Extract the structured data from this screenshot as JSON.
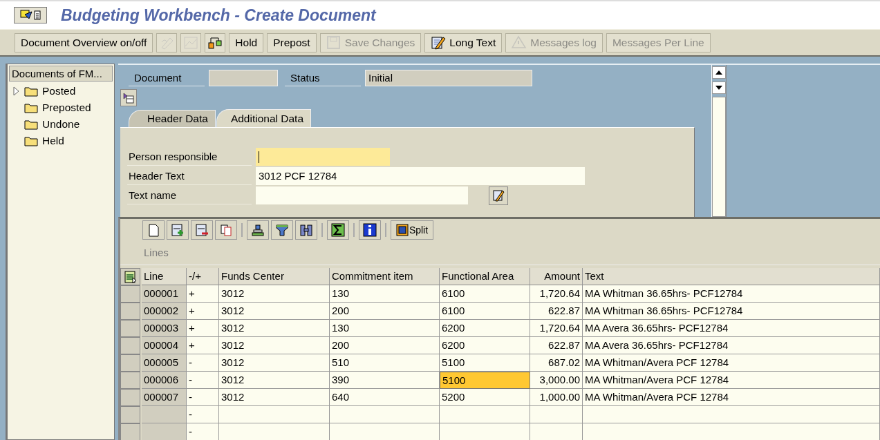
{
  "window": {
    "title": "Budgeting Workbench - Create Document"
  },
  "toolbar": [
    {
      "kind": "text",
      "label": "Document Overview on/off",
      "disabled": false
    },
    {
      "kind": "icon",
      "disabled": true
    },
    {
      "kind": "icon",
      "disabled": true
    },
    {
      "kind": "icon",
      "disabled": false
    },
    {
      "kind": "text",
      "label": "Hold",
      "disabled": false
    },
    {
      "kind": "text",
      "label": "Prepost",
      "disabled": false
    },
    {
      "kind": "icon_text",
      "label": "Save Changes",
      "disabled": true
    },
    {
      "kind": "icon_text",
      "label": "Long Text",
      "disabled": false
    },
    {
      "kind": "icon_text",
      "label": "Messages log",
      "disabled": true
    },
    {
      "kind": "text",
      "label": "Messages Per Line",
      "disabled": true
    }
  ],
  "sidebar": {
    "title": "Documents of FM...",
    "items": [
      {
        "label": "Posted",
        "expandable": true
      },
      {
        "label": "Preposted",
        "expandable": false
      },
      {
        "label": "Undone",
        "expandable": false
      },
      {
        "label": "Held",
        "expandable": false
      }
    ]
  },
  "header": {
    "document_label": "Document",
    "status_label": "Status",
    "status_value": "Initial"
  },
  "tabs": [
    {
      "label": "Header Data",
      "selected": false
    },
    {
      "label": "Additional Data",
      "selected": true
    }
  ],
  "fields": [
    {
      "kind": "text",
      "label": "Person responsible",
      "focused": true
    },
    {
      "kind": "text",
      "label": "Header Text",
      "value": "3012 PCF 12784",
      "focused": false
    },
    {
      "kind": "text_with_button",
      "label": "Text name",
      "focused": false
    }
  ],
  "grid": {
    "title": "Lines",
    "split_label": "Split",
    "columns": [
      "Line",
      "-/+",
      "Funds Center",
      "Commitment item",
      "Functional Area",
      "Amount",
      "Text"
    ],
    "rows": [
      {
        "line": "000001",
        "sign": "+",
        "funds_center": "3012",
        "commitment_item": "130",
        "functional_area": "6100",
        "amount": "1,720.64",
        "text": "MA Whitman 36.65hrs- PCF12784"
      },
      {
        "line": "000002",
        "sign": "+",
        "funds_center": "3012",
        "commitment_item": "200",
        "functional_area": "6100",
        "amount": "622.87",
        "text": "MA Whitman 36.65hrs- PCF12784"
      },
      {
        "line": "000003",
        "sign": "+",
        "funds_center": "3012",
        "commitment_item": "130",
        "functional_area": "6200",
        "amount": "1,720.64",
        "text": "MA Avera 36.65hrs- PCF12784"
      },
      {
        "line": "000004",
        "sign": "+",
        "funds_center": "3012",
        "commitment_item": "200",
        "functional_area": "6200",
        "amount": "622.87",
        "text": "MA Avera 36.65hrs- PCF12784"
      },
      {
        "line": "000005",
        "sign": "-",
        "funds_center": "3012",
        "commitment_item": "510",
        "functional_area": "5100",
        "amount": "687.02",
        "text": "MA Whitman/Avera PCF 12784"
      },
      {
        "line": "000006",
        "sign": "-",
        "funds_center": "3012",
        "commitment_item": "390",
        "functional_area": {
          "text": "5100",
          "selected": true
        },
        "amount": "3,000.00",
        "text": "MA Whitman/Avera PCF 12784"
      },
      {
        "line": "000007",
        "sign": "-",
        "funds_center": "3012",
        "commitment_item": "640",
        "functional_area": "5200",
        "amount": "1,000.00",
        "text": "MA Whitman/Avera PCF 12784"
      },
      {
        "sign": "-"
      },
      {
        "sign": "-"
      }
    ]
  }
}
